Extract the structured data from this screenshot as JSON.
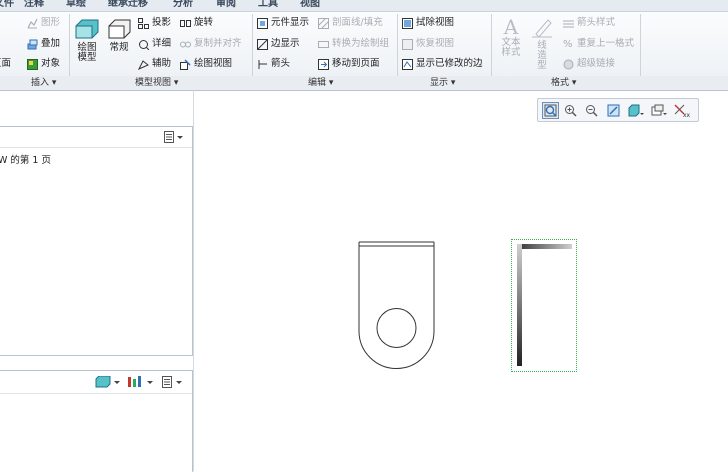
{
  "tabs": [
    "文件",
    "注释",
    "草绘",
    "继承迁移",
    "分析",
    "审阅",
    "工具",
    "视图"
  ],
  "ribbon": {
    "insert": {
      "page_partial": "页面",
      "graphics": "图形",
      "overlay": "叠加",
      "object": "对象",
      "group_label": "插入"
    },
    "model_views": {
      "drawing_model": "绘图模型",
      "general": "常规",
      "projection": "投影",
      "detailed": "详细",
      "auxiliary": "辅助",
      "rotate": "旋转",
      "copy_align": "复制并对齐",
      "drawing_view": "绘图视图",
      "group_label": "模型视图"
    },
    "edit": {
      "element_display": "元件显示",
      "edge_display": "边显示",
      "arrow": "箭头",
      "section_fill": "剖面线/填充",
      "convert_draft_group": "转换为绘制组",
      "move_to_page": "移动到页面",
      "group_label": "编辑"
    },
    "display": {
      "erase_view": "拭除视图",
      "resume_view": "恢复视图",
      "show_modified_edges": "显示已修改的边",
      "group_label": "显示"
    },
    "format": {
      "text_style": "文本样式",
      "line_style": "线造型",
      "arrow_style": "箭头样式",
      "repeat_last_format": "重复上一格式",
      "hyperlink": "超级链接",
      "group_label": "格式"
    }
  },
  "left_panel": {
    "page_text": "W 的第 1 页"
  },
  "colors": {
    "selection_box": "#33b14a",
    "accent": "#2e6fb5"
  }
}
